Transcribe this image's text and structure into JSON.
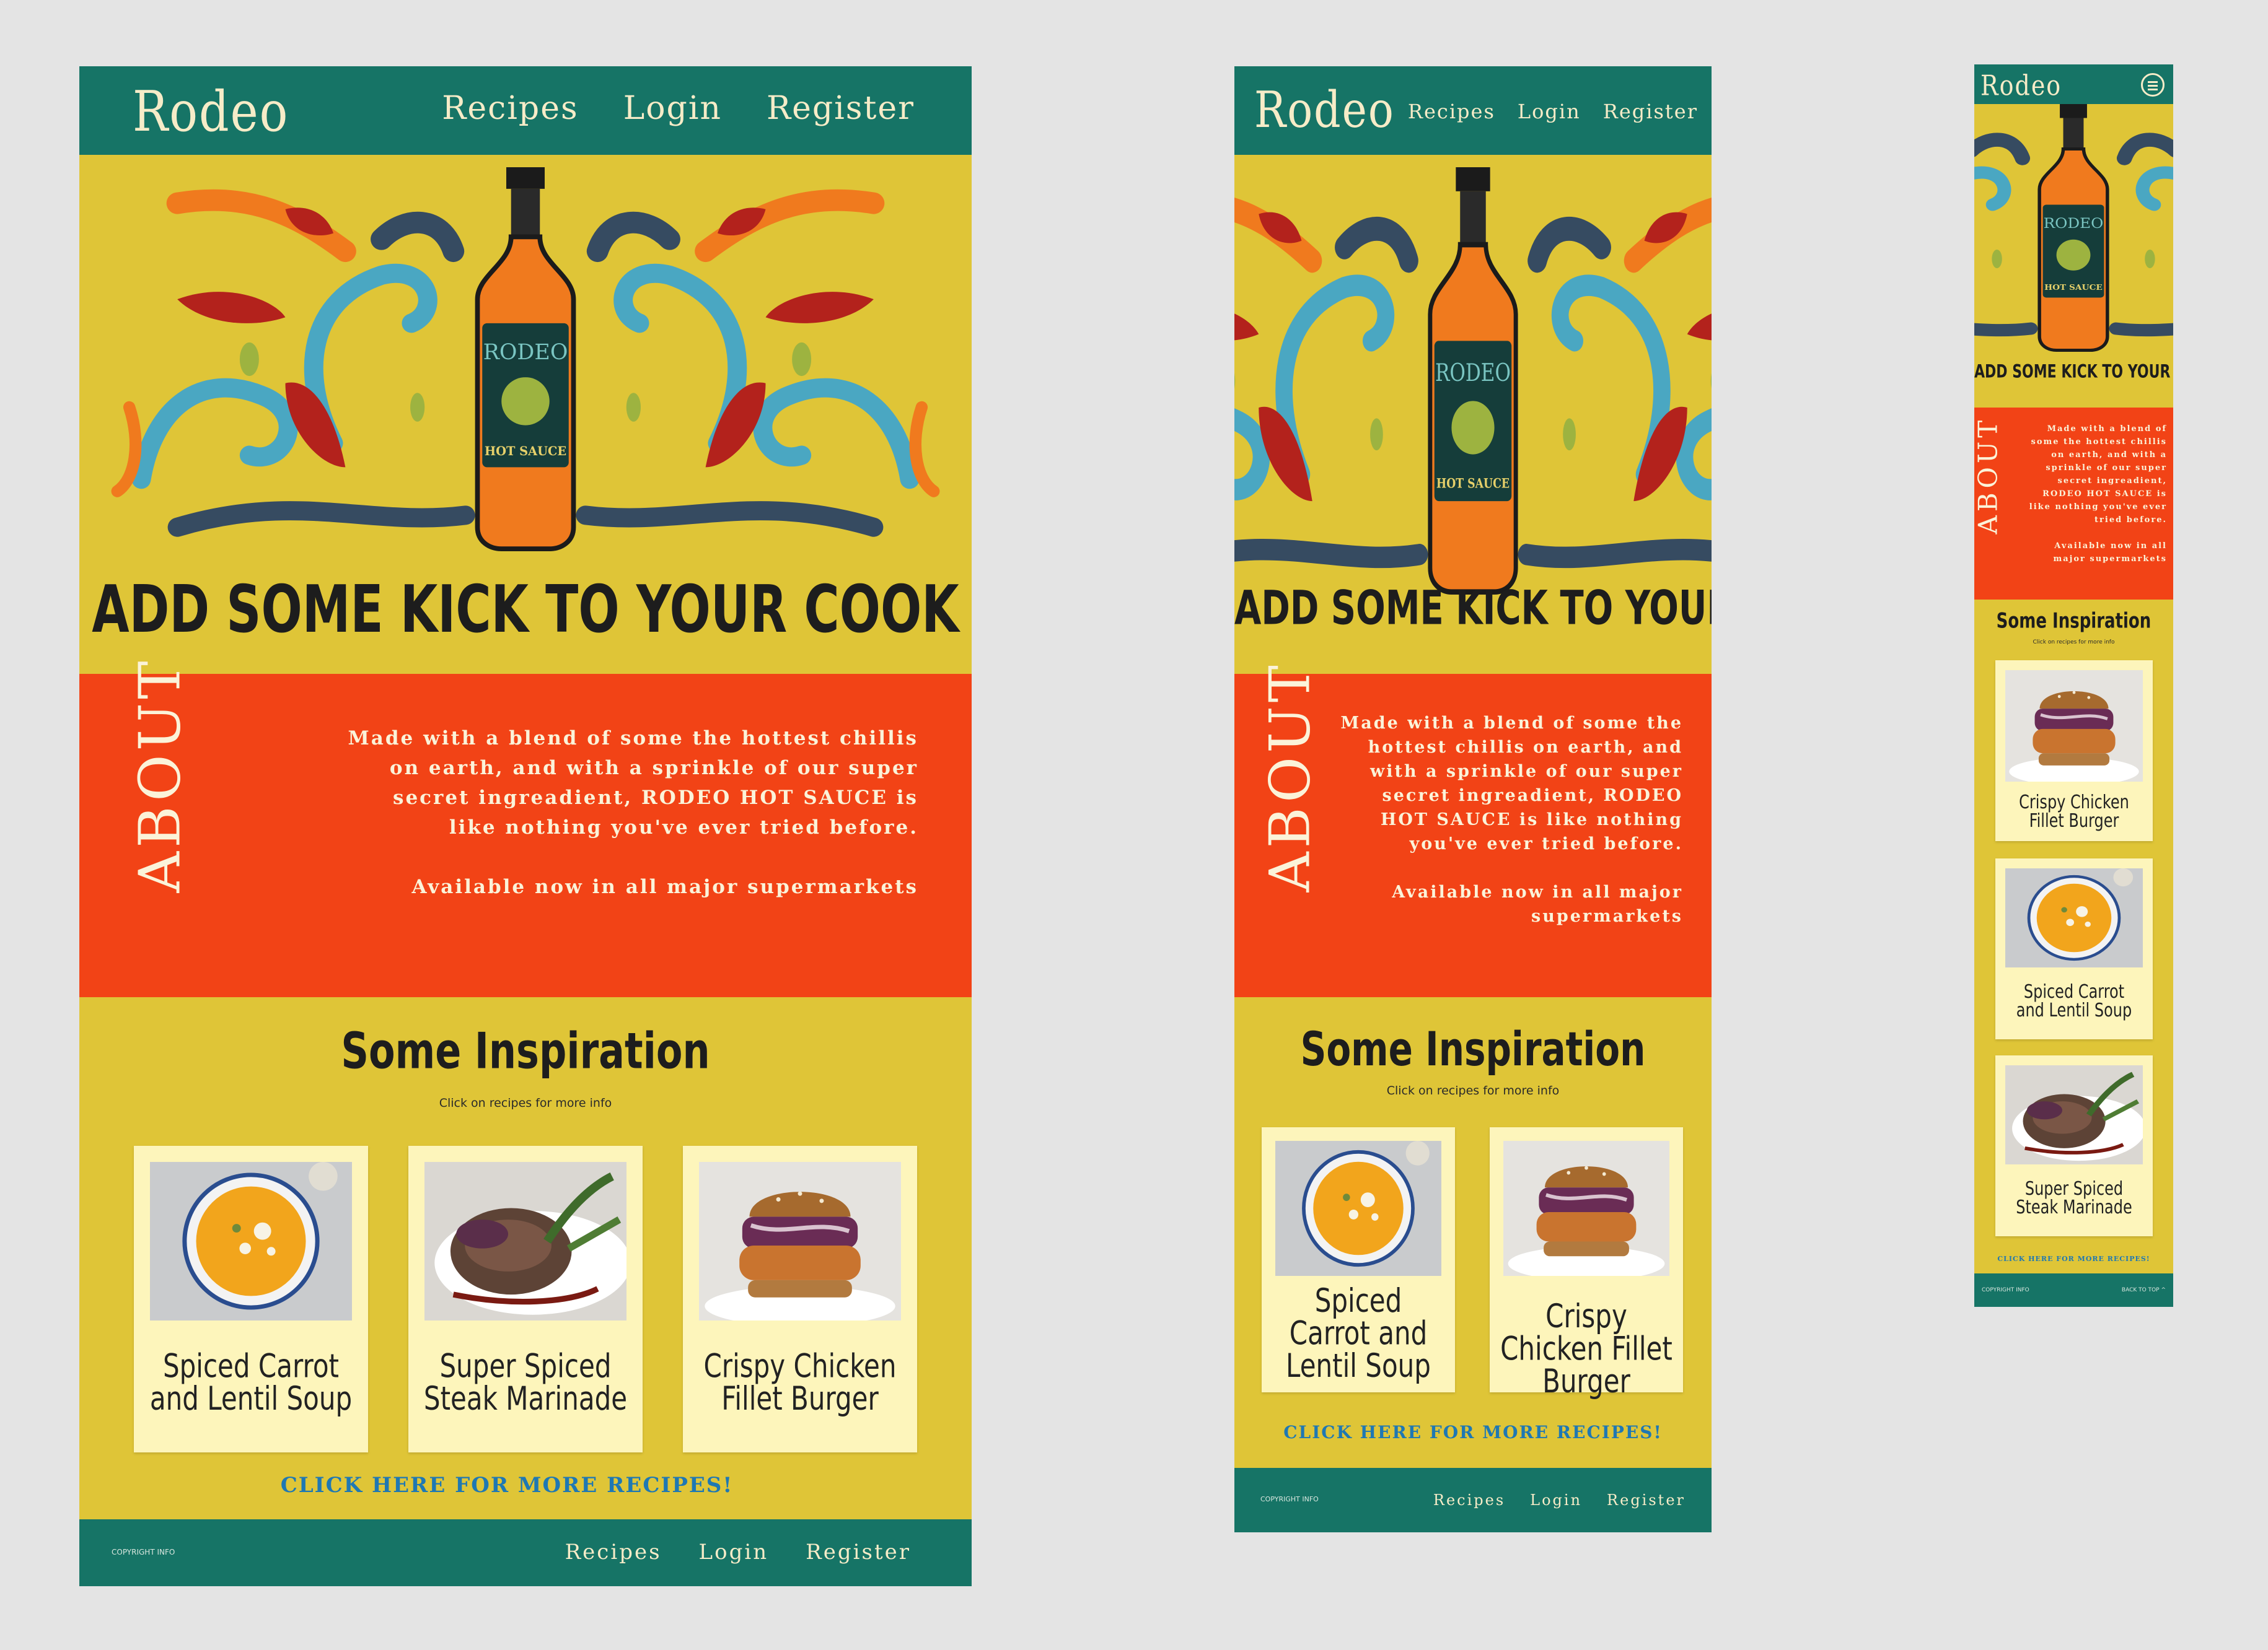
{
  "brand": "Rodeo",
  "bottle_label": {
    "brand": "RODEO",
    "product": "HOT SAUCE"
  },
  "nav": [
    "Recipes",
    "Login",
    "Register"
  ],
  "headline": "ADD SOME KICK TO YOUR COOK",
  "about": {
    "label": "ABOUT",
    "body": "Made with a blend of some the hottest chillis on earth, and with a sprinkle of our super secret ingreadient, RODEO HOT SAUCE is like nothing you've ever tried before.",
    "availability": "Available now in all major supermarkets"
  },
  "inspiration": {
    "title": "Some Inspiration",
    "subtitle": "Click on recipes for more info",
    "recipes": {
      "soup": "Spiced Carrot and Lentil Soup",
      "steak": "Super Spiced Steak Marinade",
      "burger": "Crispy Chicken Fillet Burger"
    }
  },
  "more_link": "CLICK HERE FOR MORE RECIPES!",
  "footer": {
    "copyright": "copyright info",
    "back_to_top": "back to top ^"
  },
  "colors": {
    "teal": "#167466",
    "mustard": "#dfc537",
    "orange_red": "#f24316",
    "cream": "#fdf5bb",
    "link_blue": "#1f78b3",
    "canvas": "#e4e4e4"
  }
}
